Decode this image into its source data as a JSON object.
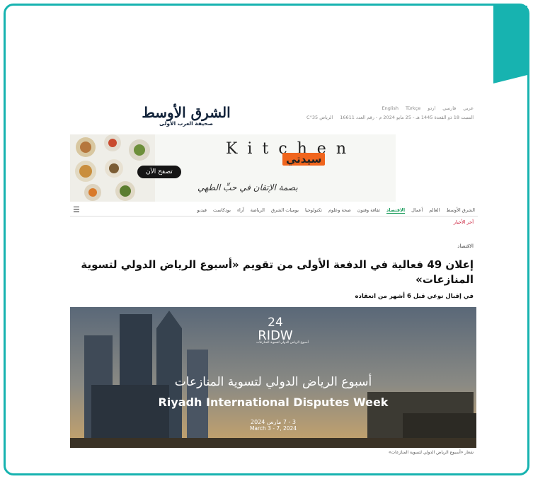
{
  "topbar": {
    "languages": [
      "عربي",
      "فارسي",
      "اردو",
      "Türkçe",
      "English"
    ],
    "date": "السبت 18 ذو القعدة 1445 هـ - 25 مايو 2024 م - رقم العدد 16611",
    "weather": "الرياض 35°C"
  },
  "logo": {
    "title": "الشرق الأوسط",
    "tagline": "صحيفة العرب الأولى"
  },
  "ad": {
    "kitchen": "Kitchen",
    "brand": "سيدتي",
    "cta": "تصفح الآن",
    "slogan": "بصمة الإتقان في حبِّ الطهي"
  },
  "nav": {
    "items": [
      "الشرق الأوسط",
      "العالم",
      "أعمال",
      "الاقتصاد",
      "ثقافة وفنون",
      "صحة وعلوم",
      "تكنولوجيا",
      "يوميات الشرق",
      "الرياضة",
      "آراء",
      "بودكاست",
      "فيديو"
    ],
    "active_index": 3,
    "menu_icon": "hamburger-icon"
  },
  "breaking": "آخر الأخبار",
  "section": "الاقتصاد",
  "headline": "إعلان 49 فعالية في الدفعة الأولى من تقويم «أسبوع الرياض الدولي لتسوية المنازعات»",
  "subhead": "في إقبال نوعي قبل 6 أشهر من انعقاده",
  "hero": {
    "logo_number": "24",
    "logo_text": "RIDW",
    "logo_caption": "أسبوع الرياض الدولي لتسوية المنازعات",
    "title_ar": "أسبوع الرياض الدولي لتسوية المنازعات",
    "title_en": "Riyadh International Disputes Week",
    "dates_ar": "3 - 7 مارس 2024",
    "dates_en": "March 3 - 7, 2024"
  },
  "caption": "شعار «أسبوع الرياض الدولي لتسوية المنازعات»",
  "colors": {
    "frame": "#17b3b0",
    "accent": "#1a9b5b",
    "brand": "#f0651d"
  }
}
